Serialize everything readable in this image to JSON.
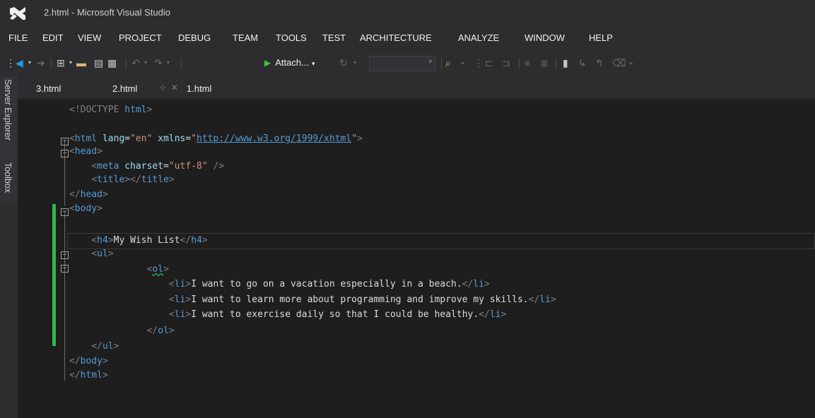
{
  "window": {
    "title": "2.html - Microsoft Visual Studio"
  },
  "menu": [
    "FILE",
    "EDIT",
    "VIEW",
    "PROJECT",
    "DEBUG",
    "TEAM",
    "TOOLS",
    "TEST",
    "ARCHITECTURE",
    "ANALYZE",
    "WINDOW",
    "HELP"
  ],
  "toolbar": {
    "attach_label": "Attach...",
    "attach_caret": "▾",
    "overflow": "₌"
  },
  "side_tabs": [
    "Server Explorer",
    "Toolbox"
  ],
  "tabs": [
    "3.html",
    "2.html",
    "1.html"
  ],
  "tab_icons": {
    "pin": "⊹",
    "close": "✕"
  },
  "code": {
    "doctype": "<!DOCTYPE",
    "doctype_name": "html",
    "html_tag": "html",
    "lang_attr": "lang",
    "lang_val": "\"en\"",
    "xmlns_attr": "xmlns",
    "xmlns_url": "http://www.w3.org/1999/xhtml",
    "head": "head",
    "meta": "meta",
    "charset_attr": "charset",
    "charset_val": "\"utf-8\"",
    "title": "title",
    "body": "body",
    "h4": "h4",
    "h4_text": "My Wish List",
    "ul": "ul",
    "ol": "ol",
    "li": "li",
    "items": [
      "I want to go on a vacation especially in a beach.",
      "I want to learn more about programming and improve my skills.",
      "I want to exercise daily so that I could be healthy."
    ]
  },
  "colors": {
    "tag": "#569cd6",
    "attr": "#9cdcfe",
    "value": "#ce9178",
    "punct": "#808080",
    "text": "#dcdcdc",
    "change": "#2fb84a",
    "editor_bg": "#1e1e1e",
    "chrome_bg": "#2d2d30"
  },
  "icons": [
    "vs-logo-icon",
    "back-icon",
    "forward-icon",
    "new-project-icon",
    "open-folder-icon",
    "save-icon",
    "save-all-icon",
    "undo-icon",
    "redo-icon",
    "start-icon",
    "refresh-icon",
    "find-in-files-icon",
    "comment-icon",
    "uncomment-icon",
    "indent-icon",
    "outdent-icon",
    "bookmark-icon",
    "next-bookmark-icon",
    "prev-bookmark-icon",
    "clear-bookmarks-icon",
    "pin-icon",
    "close-icon"
  ]
}
